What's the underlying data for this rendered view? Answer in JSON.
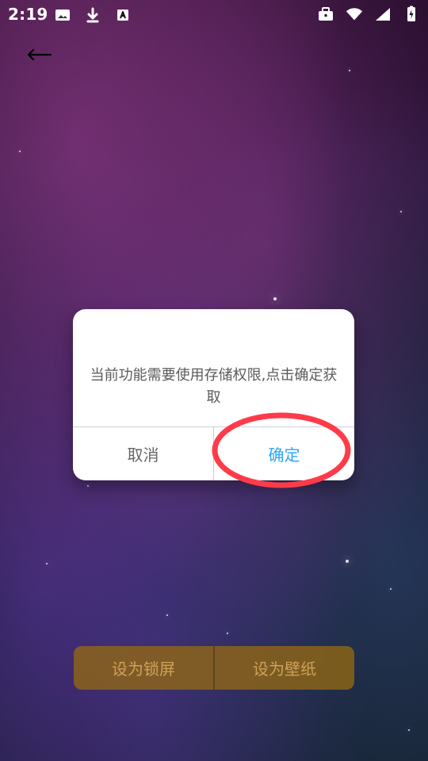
{
  "status_bar": {
    "time": "2:19",
    "left_icons": [
      "image-icon",
      "download-icon",
      "a-badge-icon"
    ],
    "right_icons": [
      "briefcase-icon",
      "wifi-icon",
      "signal-icon",
      "battery-charging-icon"
    ]
  },
  "dialog": {
    "message": "当前功能需要使用存储权限,点击确定获取",
    "cancel_label": "取消",
    "confirm_label": "确定"
  },
  "bottom_actions": {
    "lockscreen_label": "设为锁屏",
    "wallpaper_label": "设为壁纸"
  },
  "colors": {
    "dialog_confirm": "#2aa7f3",
    "annotation_red": "#ff3b4a",
    "bottom_bar": "#946812"
  }
}
